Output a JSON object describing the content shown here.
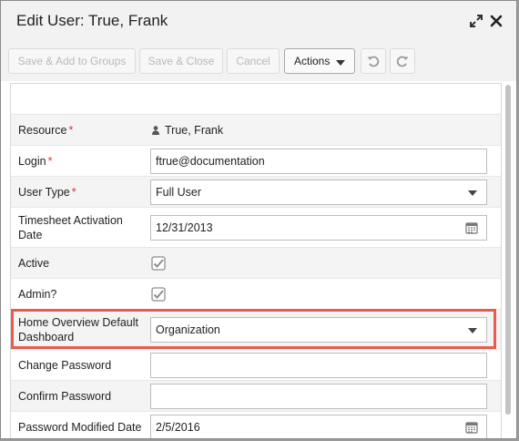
{
  "dialog": {
    "title": "Edit User: True, Frank",
    "icons": {
      "expand": "expand-icon",
      "close": "close-icon"
    }
  },
  "toolbar": {
    "save_add_label": "Save & Add to Groups",
    "save_close_label": "Save & Close",
    "cancel_label": "Cancel",
    "actions_label": "Actions",
    "undo_icon": "undo-icon",
    "redo_icon": "redo-icon"
  },
  "form": {
    "resource": {
      "label": "Resource",
      "required": "*",
      "value": "True, Frank"
    },
    "login": {
      "label": "Login",
      "required": "*",
      "value": "ftrue@documentation"
    },
    "user_type": {
      "label": "User Type",
      "required": "*",
      "value": "Full User"
    },
    "timesheet": {
      "label": "Timesheet Activation Date",
      "value": "12/31/2013"
    },
    "active": {
      "label": "Active",
      "checked": true
    },
    "admin": {
      "label": "Admin?",
      "checked": true
    },
    "home_dashboard": {
      "label": "Home Overview Default Dashboard",
      "value": "Organization"
    },
    "change_password": {
      "label": "Change Password",
      "value": ""
    },
    "confirm_password": {
      "label": "Confirm Password",
      "value": ""
    },
    "password_modified": {
      "label": "Password Modified Date",
      "value": "2/5/2016"
    }
  },
  "colors": {
    "highlight": "#ea5b4f",
    "required": "#dd3333",
    "header_bg": "#f2f2f2"
  }
}
